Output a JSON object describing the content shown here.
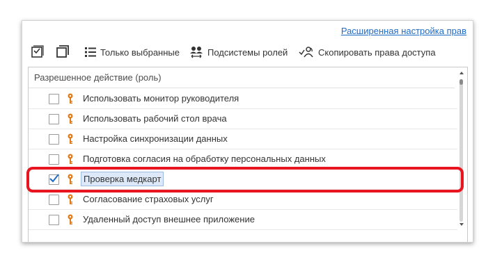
{
  "advanced_link": "Расширенная настройка прав",
  "toolbar": {
    "only_selected": "Только выбранные",
    "subsystems": "Подсистемы ролей",
    "copy_rights": "Скопировать права доступа"
  },
  "grid": {
    "column_header": "Разрешенное действие (роль)",
    "rows": [
      {
        "label": "Использовать монитор руководителя",
        "checked": false
      },
      {
        "label": "Использовать рабочий стол врача",
        "checked": false
      },
      {
        "label": "Настройка синхронизации данных",
        "checked": false
      },
      {
        "label": "Подготовка согласия на обработку персональных данных",
        "checked": false
      },
      {
        "label": "Проверка медкарт",
        "checked": true,
        "selected": true
      },
      {
        "label": "Согласование страховых услуг",
        "checked": false
      },
      {
        "label": "Удаленный доступ внешнее приложение",
        "checked": false
      }
    ]
  },
  "colors": {
    "link": "#1f6bc5",
    "key_icon": "#e07b1a",
    "highlight": "#e8141f",
    "check": "#1f6bc5"
  },
  "icons": [
    "check-all-icon",
    "uncheck-all-icon",
    "list-icon",
    "people-icon",
    "copy-rights-icon",
    "key-icon"
  ]
}
